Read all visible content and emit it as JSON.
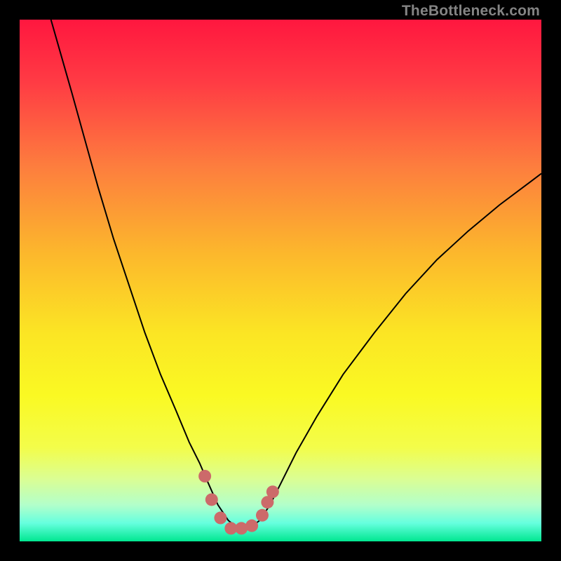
{
  "watermark": "TheBottleneck.com",
  "chart_data": {
    "type": "line",
    "title": "",
    "xlabel": "",
    "ylabel": "",
    "xlim": [
      0,
      100
    ],
    "ylim": [
      0,
      100
    ],
    "gradient_stops": [
      {
        "pos": 0.0,
        "color": "#ff173f"
      },
      {
        "pos": 0.12,
        "color": "#ff3b44"
      },
      {
        "pos": 0.28,
        "color": "#fd7d3e"
      },
      {
        "pos": 0.45,
        "color": "#fcb82c"
      },
      {
        "pos": 0.6,
        "color": "#fbe524"
      },
      {
        "pos": 0.72,
        "color": "#faf923"
      },
      {
        "pos": 0.82,
        "color": "#f3fd4a"
      },
      {
        "pos": 0.88,
        "color": "#dbfe93"
      },
      {
        "pos": 0.93,
        "color": "#b3ffca"
      },
      {
        "pos": 0.965,
        "color": "#66ffde"
      },
      {
        "pos": 1.0,
        "color": "#00e790"
      }
    ],
    "series": [
      {
        "name": "bottleneck-curve",
        "color": "#000000",
        "width": 2,
        "x": [
          6.0,
          8.0,
          10.0,
          12.5,
          15.0,
          18.0,
          21.0,
          24.0,
          27.0,
          30.0,
          32.5,
          34.5,
          36.0,
          38.0,
          40.0,
          42.0,
          44.0,
          46.0,
          48.0,
          50.0,
          53.0,
          57.0,
          62.0,
          68.0,
          74.0,
          80.0,
          86.0,
          92.0,
          98.0,
          100.0
        ],
        "y": [
          100.0,
          93.0,
          86.0,
          77.0,
          68.0,
          58.0,
          49.0,
          40.0,
          32.0,
          25.0,
          19.0,
          15.0,
          11.5,
          7.0,
          4.0,
          2.5,
          2.5,
          4.0,
          7.0,
          11.0,
          17.0,
          24.0,
          32.0,
          40.0,
          47.5,
          54.0,
          59.5,
          64.5,
          69.0,
          70.5
        ]
      }
    ],
    "markers": {
      "name": "bottom-dots",
      "color": "#cc6a6a",
      "radius": 9,
      "points": [
        {
          "x": 35.5,
          "y": 12.5
        },
        {
          "x": 36.8,
          "y": 8.0
        },
        {
          "x": 38.5,
          "y": 4.5
        },
        {
          "x": 40.5,
          "y": 2.5
        },
        {
          "x": 42.5,
          "y": 2.5
        },
        {
          "x": 44.5,
          "y": 3.0
        },
        {
          "x": 46.5,
          "y": 5.0
        },
        {
          "x": 47.5,
          "y": 7.5
        },
        {
          "x": 48.5,
          "y": 9.5
        }
      ]
    }
  }
}
